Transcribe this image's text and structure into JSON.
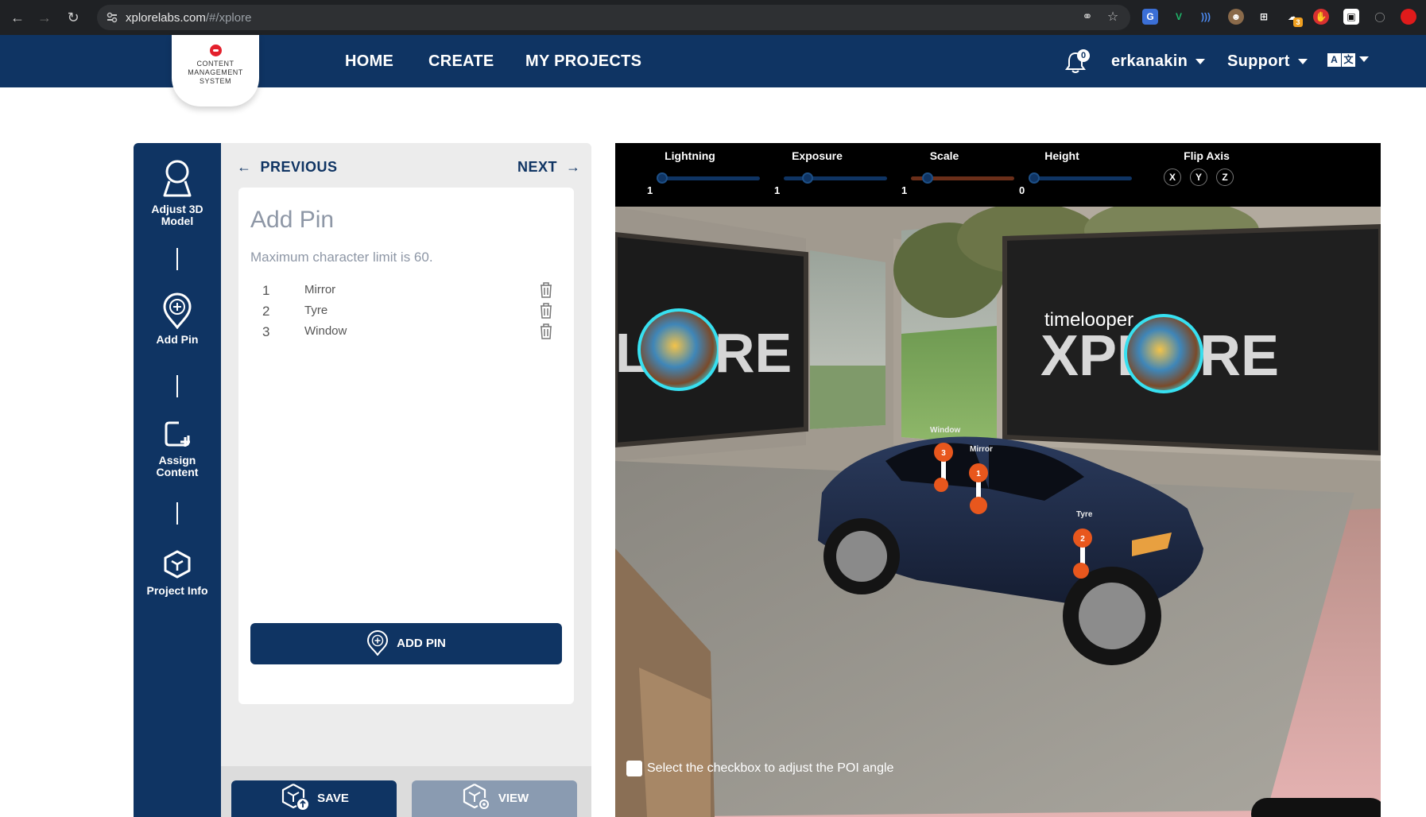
{
  "browser": {
    "url_host": "xplorelabs.com",
    "url_path": "/#/xplore",
    "ext_badge": "3"
  },
  "header": {
    "logo_text": "CONTENT MANAGEMENT SYSTEM",
    "nav": [
      "HOME",
      "CREATE",
      "MY PROJECTS"
    ],
    "notifications_count": "0",
    "username": "erkanakin",
    "support_label": "Support",
    "lang_a": "A",
    "lang_b": "文"
  },
  "steps": [
    {
      "label_1": "Adjust 3D",
      "label_2": "Model",
      "icon": "person-bust-icon"
    },
    {
      "label_1": "Add Pin",
      "label_2": "",
      "icon": "map-pin-plus-icon"
    },
    {
      "label_1": "Assign",
      "label_2": "Content",
      "icon": "square-plus-icon"
    },
    {
      "label_1": "Project Info",
      "label_2": "",
      "icon": "cube-icon"
    }
  ],
  "panel": {
    "previous_label": "PREVIOUS",
    "next_label": "NEXT",
    "title": "Add Pin",
    "hint": "Maximum character limit is 60.",
    "pins": [
      {
        "num": "1",
        "name": "Mirror"
      },
      {
        "num": "2",
        "name": "Tyre"
      },
      {
        "num": "3",
        "name": "Window"
      }
    ],
    "add_pin_label": "ADD PIN",
    "save_label": "SAVE",
    "view_label": "VIEW"
  },
  "viewer": {
    "controls": [
      {
        "label": "Lightning",
        "value": "1",
        "level": 0.0
      },
      {
        "label": "Exposure",
        "value": "1",
        "level": 0.2
      },
      {
        "label": "Scale",
        "value": "1",
        "level": 0.12
      },
      {
        "label": "Height",
        "value": "0",
        "level": 0.0
      }
    ],
    "flip_axis_label": "Flip Axis",
    "axes": [
      "X",
      "Y",
      "Z"
    ],
    "scene_labels": {
      "window": "Window",
      "mirror": "Mirror",
      "tyre": "Tyre",
      "poster_brand": "timelooper",
      "poster_word_left": "XPL",
      "poster_word_right": "RE",
      "poster_left_word": "RE"
    },
    "pin_markers": [
      "3",
      "1",
      "2"
    ],
    "poi_text": "Select the checkbox to adjust the POI angle"
  },
  "colors": {
    "brand_navy": "#0f3463",
    "pin_orange": "#e8571d",
    "view_button": "#8a9bb1"
  }
}
